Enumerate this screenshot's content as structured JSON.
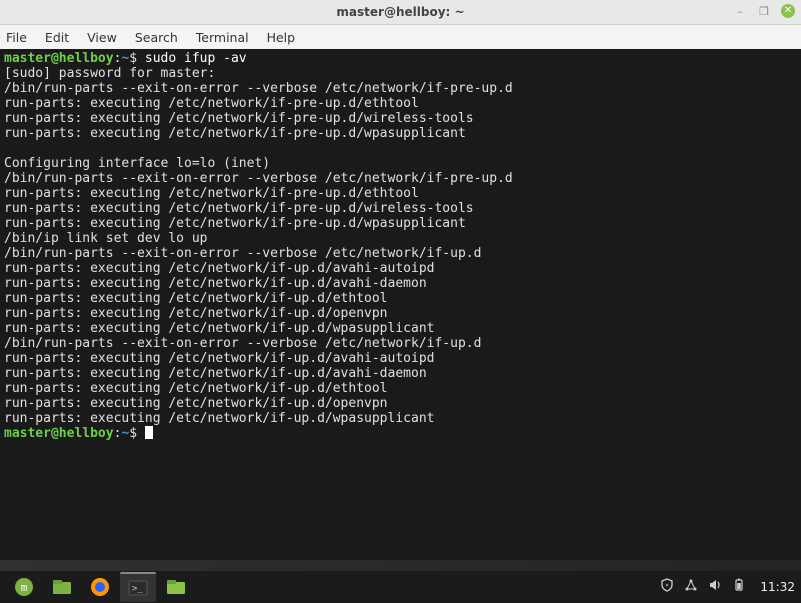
{
  "window": {
    "title": "master@hellboy: ~",
    "controls": {
      "minimize": "–",
      "maximize": "❐",
      "close": "✕"
    }
  },
  "menubar": {
    "file": "File",
    "edit": "Edit",
    "view": "View",
    "search": "Search",
    "terminal": "Terminal",
    "help": "Help"
  },
  "prompt": {
    "user_host": "master@hellboy",
    "sep": ":",
    "path": "~",
    "dollar": "$"
  },
  "terminal": {
    "command": "sudo ifup -av",
    "lines": [
      "[sudo] password for master:",
      "/bin/run-parts --exit-on-error --verbose /etc/network/if-pre-up.d",
      "run-parts: executing /etc/network/if-pre-up.d/ethtool",
      "run-parts: executing /etc/network/if-pre-up.d/wireless-tools",
      "run-parts: executing /etc/network/if-pre-up.d/wpasupplicant",
      "",
      "Configuring interface lo=lo (inet)",
      "/bin/run-parts --exit-on-error --verbose /etc/network/if-pre-up.d",
      "run-parts: executing /etc/network/if-pre-up.d/ethtool",
      "run-parts: executing /etc/network/if-pre-up.d/wireless-tools",
      "run-parts: executing /etc/network/if-pre-up.d/wpasupplicant",
      "/bin/ip link set dev lo up",
      "/bin/run-parts --exit-on-error --verbose /etc/network/if-up.d",
      "run-parts: executing /etc/network/if-up.d/avahi-autoipd",
      "run-parts: executing /etc/network/if-up.d/avahi-daemon",
      "run-parts: executing /etc/network/if-up.d/ethtool",
      "run-parts: executing /etc/network/if-up.d/openvpn",
      "run-parts: executing /etc/network/if-up.d/wpasupplicant",
      "/bin/run-parts --exit-on-error --verbose /etc/network/if-up.d",
      "run-parts: executing /etc/network/if-up.d/avahi-autoipd",
      "run-parts: executing /etc/network/if-up.d/avahi-daemon",
      "run-parts: executing /etc/network/if-up.d/ethtool",
      "run-parts: executing /etc/network/if-up.d/openvpn",
      "run-parts: executing /etc/network/if-up.d/wpasupplicant"
    ]
  },
  "panel": {
    "clock": "11:32",
    "icons": {
      "menu": "mint-menu-icon",
      "files": "files-icon",
      "firefox": "firefox-icon",
      "terminal": "terminal-icon",
      "filemgr": "file-manager-icon",
      "shield": "shield-icon",
      "network": "network-icon",
      "volume": "volume-icon",
      "battery": "battery-icon"
    }
  }
}
